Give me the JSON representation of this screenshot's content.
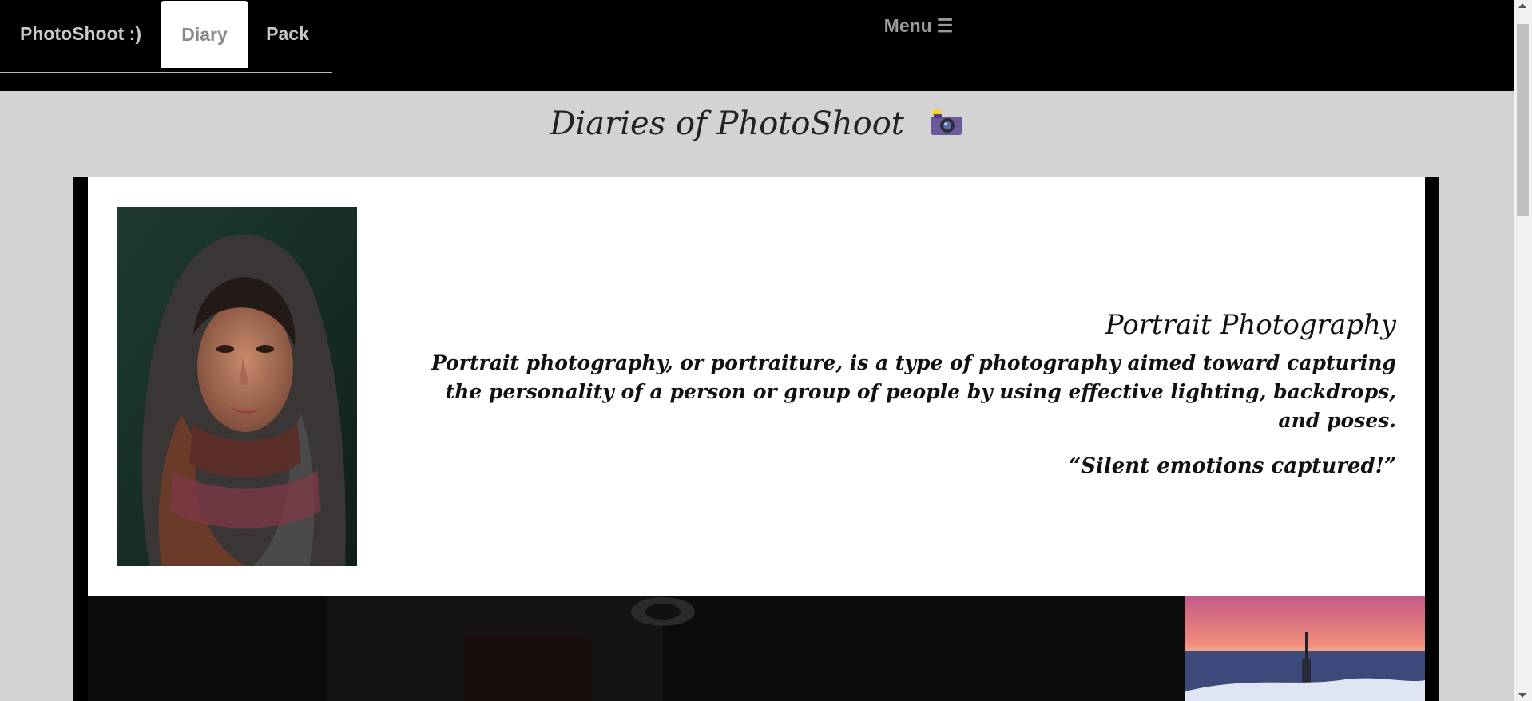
{
  "nav": {
    "brand": "PhotoShoot :)",
    "items": [
      "Diary",
      "Pack"
    ],
    "active": "Diary"
  },
  "menu": {
    "label": "Menu",
    "icon": "hamburger-icon"
  },
  "page": {
    "title": "Diaries of PhotoShoot",
    "title_icon": "camera-icon"
  },
  "card": {
    "heading": "Portrait Photography",
    "body": "Portrait photography, or portraiture, is a type of photography aimed toward capturing the personality of a person or group of people by using effective lighting, backdrops, and poses.",
    "quote": "“Silent emotions captured!”"
  },
  "colors": {
    "topbar": "#000000",
    "page_bg": "#d3d3d3",
    "card_bg": "#ffffff",
    "active_tab_bg": "#ffffff"
  }
}
